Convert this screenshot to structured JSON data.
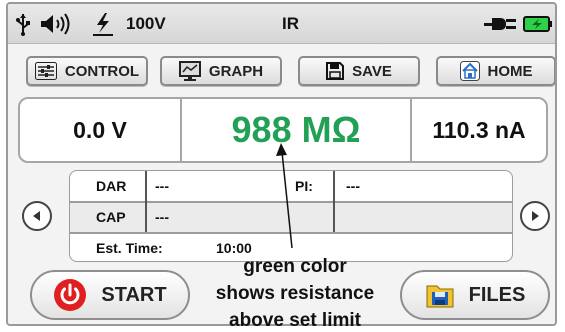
{
  "status_bar": {
    "voltage_setting": "100V",
    "mode": "IR",
    "icons": [
      "usb-icon",
      "speaker-icon",
      "high-voltage-icon",
      "power-plug-icon",
      "battery-icon"
    ]
  },
  "toolbar": {
    "control_label": "CONTROL",
    "graph_label": "GRAPH",
    "save_label": "SAVE",
    "home_label": "HOME"
  },
  "readout": {
    "voltage": "0.0 V",
    "resistance": "988 MΩ",
    "resistance_color": "#22a055",
    "current": "110.3 nA"
  },
  "info_table": {
    "dar_label": "DAR",
    "dar_value": "---",
    "pi_label": "PI:",
    "pi_value": "---",
    "cap_label": "CAP",
    "cap_value": "---",
    "est_time_label": "Est. Time:",
    "est_time_value": "10:00"
  },
  "navigation": {
    "prev_icon": "triangle-left-icon",
    "next_icon": "triangle-right-icon"
  },
  "actions": {
    "start_label": "START",
    "files_label": "FILES"
  },
  "annotation": {
    "line1": "green color",
    "line2": "shows resistance",
    "line3": "above set limit"
  },
  "colors": {
    "start_red": "#e02020",
    "battery_green": "#2fd04a",
    "files_blue": "#1f5fb8",
    "files_yellow": "#f1c232"
  }
}
